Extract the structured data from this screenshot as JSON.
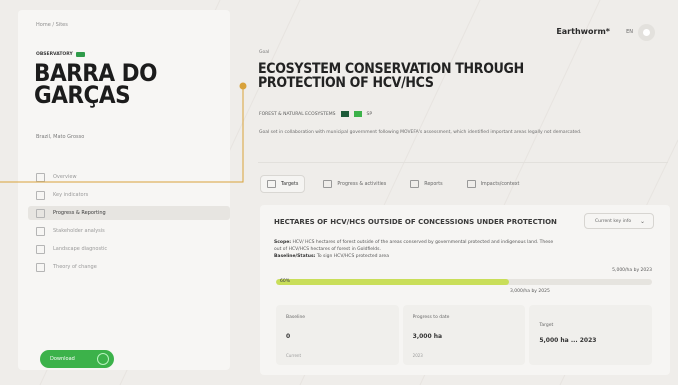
{
  "sidebar": {
    "breadcrumb": "Home / Sites",
    "tag": "OBSERVATORY",
    "title": "BARRA DO GARÇAS",
    "subtitle": "Brazil, Mato Grosso",
    "nav": [
      {
        "label": "Overview",
        "active": false
      },
      {
        "label": "Key indicators",
        "active": false
      },
      {
        "label": "Progress & Reporting",
        "active": true
      },
      {
        "label": "Stakeholder analysis",
        "active": false
      },
      {
        "label": "Landscape diagnostic",
        "active": false
      },
      {
        "label": "Theory of change",
        "active": false
      }
    ],
    "cta": "Download"
  },
  "header": {
    "brand": "Earthworm*",
    "lang": "EN",
    "eyebrow": "Goal",
    "headline": "ECOSYSTEM CONSERVATION THROUGH PROTECTION OF HCV/HCS",
    "headline_sub": "FOREST & NATURAL ECOSYSTEMS",
    "headline_sub_suffix": "SP",
    "description": "Goal set in collaboration with municipal government following MOVEFA's assessment, which identified important areas legally not demarcated."
  },
  "tabs": [
    {
      "label": "Targets",
      "active": true
    },
    {
      "label": "Progress & activities",
      "active": false
    },
    {
      "label": "Reports",
      "active": false
    },
    {
      "label": "Impacts/context",
      "active": false
    }
  ],
  "panel": {
    "heading": "HECTARES OF HCV/HCS OUTSIDE OF CONCESSIONS UNDER PROTECTION",
    "select": "Current key info",
    "scope_label": "Scope:",
    "scope_text": "HCV/ HCS hectares of forest outside of the areas conserved by governmental protected and indigenous land. These out of HCV/HCS hectares of forest in Goldfields.",
    "baseline_label": "Baseline/Status:",
    "baseline_text": "To sign HCV/HCS protected area",
    "bar_top_label": "5,000/ha by 2023",
    "bar_value": 0.62,
    "bar_pct": "60%",
    "bar_bottom_label": "3,000/ha by 2025",
    "stats": [
      {
        "key": "Baseline",
        "value": "0",
        "footer": "Current"
      },
      {
        "key": "Progress to date",
        "value": "3,000 ha",
        "footer": "2023"
      },
      {
        "key": "Target",
        "value": "5,000 ha ... 2023",
        "footer": ""
      }
    ]
  },
  "colors": {
    "accent_green": "#3cb24a",
    "bar_fill": "#c9de59",
    "callout": "#d8a23b"
  }
}
